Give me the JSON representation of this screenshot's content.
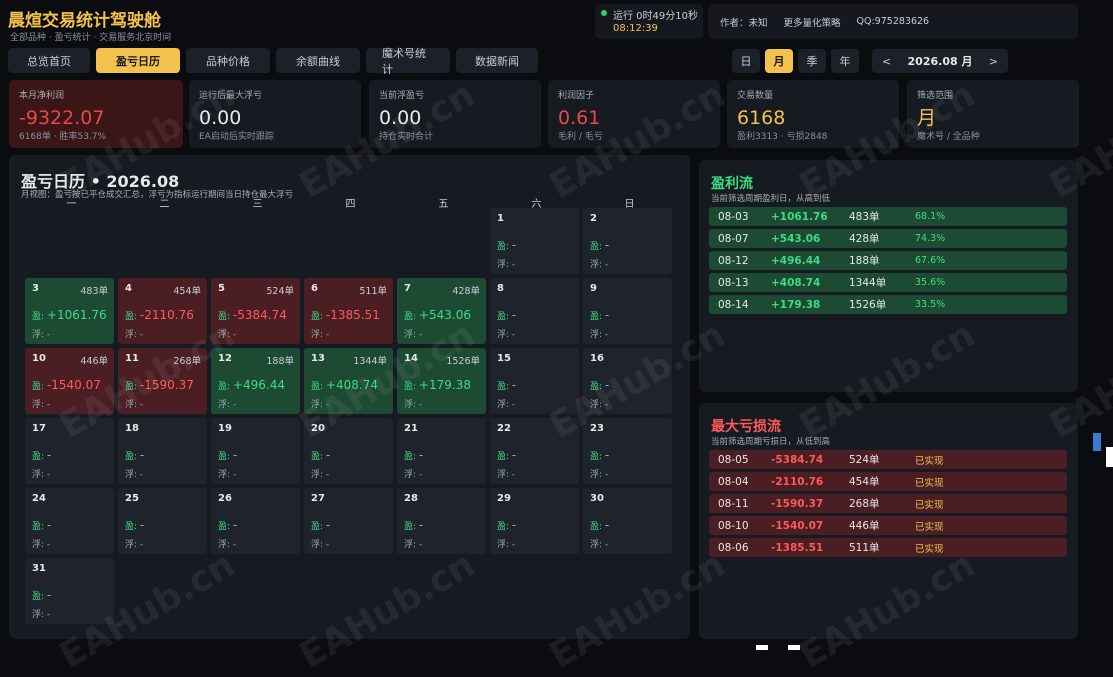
{
  "header": {
    "title": "晨煊交易统计驾驶舱",
    "subtitle": "全部品种 · 盈亏统计 · 交易服务北京时间"
  },
  "runtime": {
    "label": "运行 0时49分10秒",
    "time": "08:12:39"
  },
  "info": {
    "author": "作者：未知",
    "more": "更多量化策略",
    "qq": "QQ:975283626"
  },
  "tabs": [
    "总览首页",
    "盈亏日历",
    "品种价格",
    "余额曲线",
    "魔术号统计",
    "数据新闻"
  ],
  "active_tab": "盈亏日历",
  "period": [
    "日",
    "月",
    "季",
    "年"
  ],
  "active_period": "月",
  "month_nav": {
    "prev": "<",
    "month": "2026.08 月",
    "next": ">"
  },
  "stats": [
    {
      "label": "本月净利润",
      "value": "-9322.07",
      "sub": "6168单 · 胜率53.7%"
    },
    {
      "label": "运行后最大浮亏",
      "value": "0.00",
      "sub": "EA启动后实时跟踪"
    },
    {
      "label": "当前浮盈亏",
      "value": "0.00",
      "sub": "持仓实时合计"
    },
    {
      "label": "利润因子",
      "value": "0.61",
      "sub": "毛利 / 毛亏"
    },
    {
      "label": "交易数量",
      "value": "6168",
      "sub": "盈利3313 · 亏损2848"
    },
    {
      "label": "筛选范围",
      "value": "月",
      "sub": "魔术号 / 全品种"
    }
  ],
  "calendar": {
    "title": "盈亏日历 • 2026.08",
    "sub": "月视图：盈亏按已平仓成交汇总，浮亏为指标运行期间当日持仓最大浮亏",
    "weekdays": [
      "一",
      "二",
      "三",
      "四",
      "五",
      "六",
      "日"
    ],
    "profit_label": "盈:",
    "float_label": "浮:",
    "days": [
      {
        "d": "1",
        "pnl": "-",
        "orders": "",
        "float": "-",
        "state": ""
      },
      {
        "d": "2",
        "pnl": "-",
        "orders": "",
        "float": "-",
        "state": ""
      },
      {
        "d": "3",
        "pnl": "+1061.76",
        "orders": "483单",
        "float": "-",
        "state": "g"
      },
      {
        "d": "4",
        "pnl": "-2110.76",
        "orders": "454单",
        "float": "-",
        "state": "r"
      },
      {
        "d": "5",
        "pnl": "-5384.74",
        "orders": "524单",
        "float": "-",
        "state": "r"
      },
      {
        "d": "6",
        "pnl": "-1385.51",
        "orders": "511单",
        "float": "-",
        "state": "r"
      },
      {
        "d": "7",
        "pnl": "+543.06",
        "orders": "428单",
        "float": "-",
        "state": "g"
      },
      {
        "d": "8",
        "pnl": "-",
        "orders": "",
        "float": "-",
        "state": ""
      },
      {
        "d": "9",
        "pnl": "-",
        "orders": "",
        "float": "-",
        "state": ""
      },
      {
        "d": "10",
        "pnl": "-1540.07",
        "orders": "446单",
        "float": "-",
        "state": "r"
      },
      {
        "d": "11",
        "pnl": "-1590.37",
        "orders": "268单",
        "float": "-",
        "state": "r"
      },
      {
        "d": "12",
        "pnl": "+496.44",
        "orders": "188单",
        "float": "-",
        "state": "g"
      },
      {
        "d": "13",
        "pnl": "+408.74",
        "orders": "1344单",
        "float": "-",
        "state": "g"
      },
      {
        "d": "14",
        "pnl": "+179.38",
        "orders": "1526单",
        "float": "-",
        "state": "g"
      },
      {
        "d": "15",
        "pnl": "-",
        "orders": "",
        "float": "-",
        "state": ""
      },
      {
        "d": "16",
        "pnl": "-",
        "orders": "",
        "float": "-",
        "state": ""
      },
      {
        "d": "17",
        "pnl": "-",
        "orders": "",
        "float": "-",
        "state": ""
      },
      {
        "d": "18",
        "pnl": "-",
        "orders": "",
        "float": "-",
        "state": ""
      },
      {
        "d": "19",
        "pnl": "-",
        "orders": "",
        "float": "-",
        "state": ""
      },
      {
        "d": "20",
        "pnl": "-",
        "orders": "",
        "float": "-",
        "state": ""
      },
      {
        "d": "21",
        "pnl": "-",
        "orders": "",
        "float": "-",
        "state": ""
      },
      {
        "d": "22",
        "pnl": "-",
        "orders": "",
        "float": "-",
        "state": ""
      },
      {
        "d": "23",
        "pnl": "-",
        "orders": "",
        "float": "-",
        "state": ""
      },
      {
        "d": "24",
        "pnl": "-",
        "orders": "",
        "float": "-",
        "state": ""
      },
      {
        "d": "25",
        "pnl": "-",
        "orders": "",
        "float": "-",
        "state": ""
      },
      {
        "d": "26",
        "pnl": "-",
        "orders": "",
        "float": "-",
        "state": ""
      },
      {
        "d": "27",
        "pnl": "-",
        "orders": "",
        "float": "-",
        "state": ""
      },
      {
        "d": "28",
        "pnl": "-",
        "orders": "",
        "float": "-",
        "state": ""
      },
      {
        "d": "29",
        "pnl": "-",
        "orders": "",
        "float": "-",
        "state": ""
      },
      {
        "d": "30",
        "pnl": "-",
        "orders": "",
        "float": "-",
        "state": ""
      },
      {
        "d": "31",
        "pnl": "-",
        "orders": "",
        "float": "-",
        "state": ""
      }
    ]
  },
  "profit_flow": {
    "title": "盈利流",
    "sub": "当前筛选周期盈利日，从高到低",
    "rows": [
      {
        "date": "08-03",
        "value": "+1061.76",
        "orders": "483单",
        "rate": "68.1%"
      },
      {
        "date": "08-07",
        "value": "+543.06",
        "orders": "428单",
        "rate": "74.3%"
      },
      {
        "date": "08-12",
        "value": "+496.44",
        "orders": "188单",
        "rate": "67.6%"
      },
      {
        "date": "08-13",
        "value": "+408.74",
        "orders": "1344单",
        "rate": "35.6%"
      },
      {
        "date": "08-14",
        "value": "+179.38",
        "orders": "1526单",
        "rate": "33.5%"
      }
    ]
  },
  "loss_flow": {
    "title": "最大亏损流",
    "sub": "当前筛选周期亏损日，从低到高",
    "rows": [
      {
        "date": "08-05",
        "value": "-5384.74",
        "orders": "524单",
        "status": "已实现"
      },
      {
        "date": "08-04",
        "value": "-2110.76",
        "orders": "454单",
        "status": "已实现"
      },
      {
        "date": "08-11",
        "value": "-1590.37",
        "orders": "268单",
        "status": "已实现"
      },
      {
        "date": "08-10",
        "value": "-1540.07",
        "orders": "446单",
        "status": "已实现"
      },
      {
        "date": "08-06",
        "value": "-1385.51",
        "orders": "511单",
        "status": "已实现"
      }
    ]
  },
  "watermark": "EAHub.cn",
  "colors": {
    "gold": "#f2c14e",
    "green": "#3ddc84",
    "red": "#ff5a5a",
    "bg": "#0a0c10"
  }
}
